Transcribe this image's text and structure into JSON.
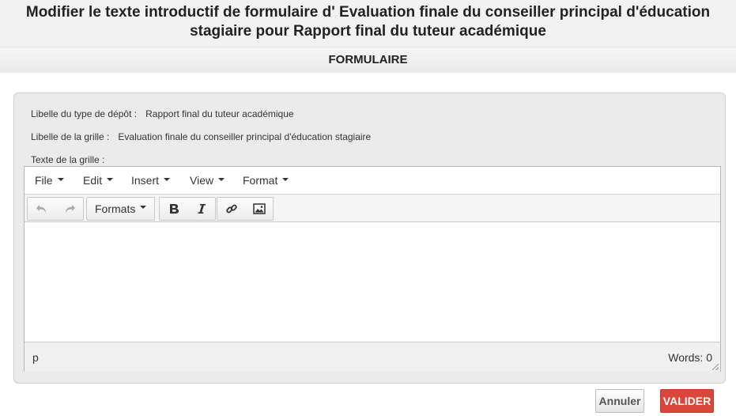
{
  "page": {
    "title_line1": "Modifier le texte introductif de formulaire d' Evaluation finale du conseiller principal d'éducation",
    "title_line2": "stagiaire pour Rapport final du tuteur académique",
    "section": "FORMULAIRE"
  },
  "form": {
    "depot_label": "Libelle du type de dépôt :",
    "depot_value": "Rapport final du tuteur académique",
    "grille_label": "Libelle de la grille :",
    "grille_value": "Evaluation finale du conseiller principal d'éducation stagiaire",
    "texte_label": "Texte de la grille :"
  },
  "editor": {
    "menu": [
      "File",
      "Edit",
      "Insert",
      "View",
      "Format"
    ],
    "toolbar": {
      "undo_icon": "undo-icon",
      "redo_icon": "redo-icon",
      "formats_label": "Formats",
      "bold_icon": "bold-icon",
      "italic_icon": "italic-icon",
      "link_icon": "link-icon",
      "image_icon": "image-icon"
    },
    "status_path": "p",
    "word_count": "Words: 0"
  },
  "actions": {
    "cancel_label": "Annuler",
    "submit_label": "VALIDER"
  },
  "colors": {
    "submit_bg": "#d9473b",
    "panel_bg": "#ebebeb"
  }
}
